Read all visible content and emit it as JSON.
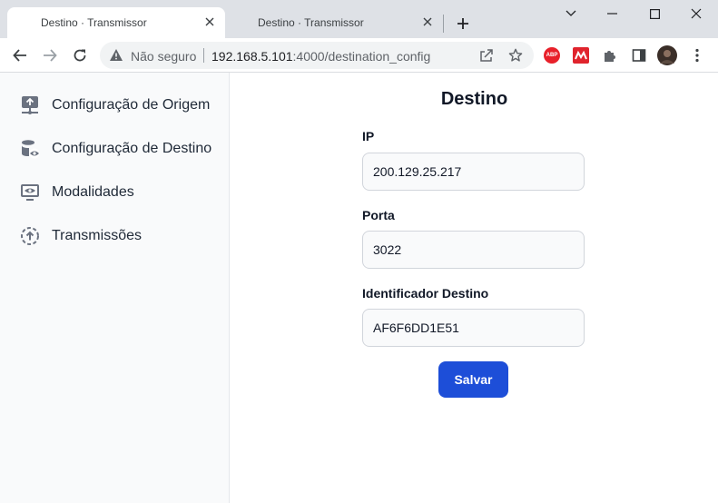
{
  "browser": {
    "tabs": [
      {
        "title": "Destino · Transmissor",
        "active": true
      },
      {
        "title": "Destino · Transmissor",
        "active": false
      }
    ],
    "security_label": "Não seguro",
    "url_host": "192.168.5.101",
    "url_rest": ":4000/destination_config",
    "extensions": {
      "abp_label": "ABP"
    },
    "icons": [
      "back-icon",
      "forward-icon",
      "reload-icon",
      "warning-icon",
      "share-icon",
      "star-icon",
      "puzzle-icon",
      "sidepanel-icon",
      "menu-icon"
    ]
  },
  "sidebar": {
    "items": [
      {
        "label": "Configuração de Origem",
        "icon": "upload-server-icon"
      },
      {
        "label": "Configuração de Destino",
        "icon": "database-eye-icon"
      },
      {
        "label": "Modalidades",
        "icon": "monitor-eye-icon"
      },
      {
        "label": "Transmissões",
        "icon": "circle-upload-icon"
      }
    ]
  },
  "form": {
    "title": "Destino",
    "fields": [
      {
        "label": "IP",
        "value": "200.129.25.217"
      },
      {
        "label": "Porta",
        "value": "3022"
      },
      {
        "label": "Identificador Destino",
        "value": "AF6F6DD1E51"
      }
    ],
    "submit_label": "Salvar"
  },
  "colors": {
    "primary": "#1d4ed8",
    "sidebar_bg": "#f9fafb",
    "chrome_bg": "#dee1e6"
  }
}
